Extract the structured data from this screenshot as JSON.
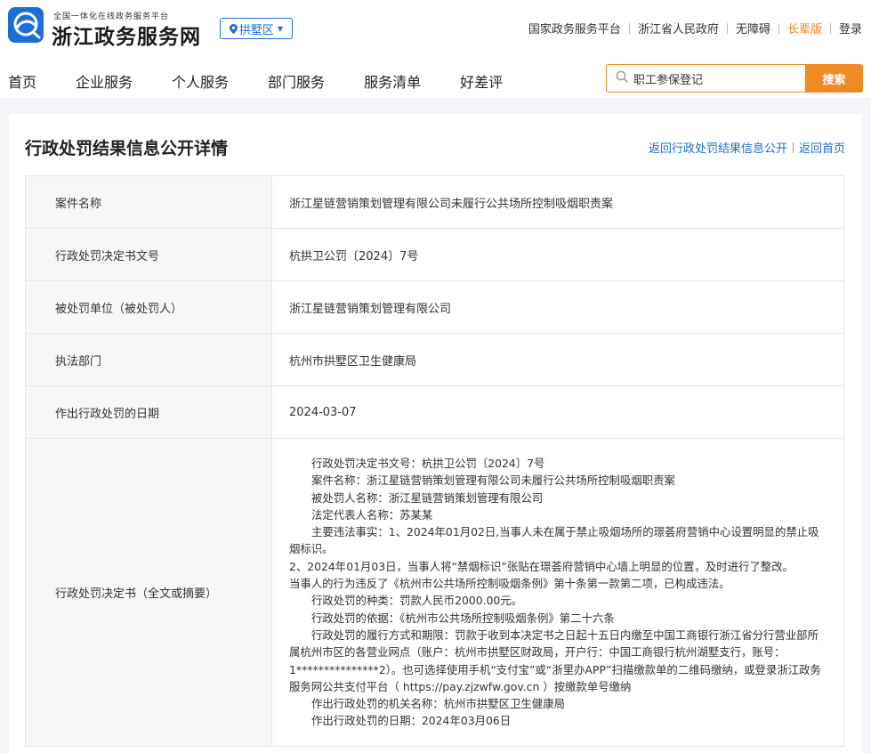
{
  "header": {
    "logo_subtitle": "全国一体化在线政务服务平台",
    "logo_title": "浙江政务服务网",
    "region": "拱墅区",
    "top_links": [
      "国家政务服务平台",
      "浙江省人民政府",
      "无障碍",
      "长辈版",
      "登录"
    ],
    "nav": [
      "首页",
      "企业服务",
      "个人服务",
      "部门服务",
      "服务清单",
      "好差评"
    ],
    "search": {
      "value": "职工参保登记",
      "button": "搜索"
    },
    "colors": {
      "brand_blue": "#1d6fd3",
      "accent_orange": "#f08a24"
    }
  },
  "page": {
    "title": "行政处罚结果信息公开详情",
    "links": [
      "返回行政处罚结果信息公开",
      "返回首页"
    ]
  },
  "details": {
    "rows": [
      {
        "label": "案件名称",
        "value": "浙江星链营销策划管理有限公司未履行公共场所控制吸烟职责案"
      },
      {
        "label": "行政处罚决定书文号",
        "value": "杭拱卫公罚〔2024〕7号"
      },
      {
        "label": "被处罚单位（被处罚人）",
        "value": "浙江星链营销策划管理有限公司"
      },
      {
        "label": "执法部门",
        "value": "杭州市拱墅区卫生健康局"
      },
      {
        "label": "作出行政处罚的日期",
        "value": "2024-03-07"
      }
    ],
    "decision": {
      "label": "行政处罚决定书（全文或摘要）",
      "paragraphs": [
        "行政处罚决定书文号：杭拱卫公罚〔2024〕7号",
        "案件名称：浙江星链营销策划管理有限公司未履行公共场所控制吸烟职责案",
        "被处罚人名称：浙江星链营销策划管理有限公司",
        "法定代表人名称：苏某某",
        "主要违法事实：1、2024年01月02日,当事人未在属于禁止吸烟场所的璟荟府营销中心设置明显的禁止吸烟标识。",
        "2、2024年01月03日，当事人将“禁烟标识”张贴在璟荟府营销中心墙上明显的位置，及时进行了整改。",
        "当事人的行为违反了《杭州市公共场所控制吸烟条例》第十条第一款第二项，已构成违法。",
        "行政处罚的种类：罚款人民币2000.00元。",
        "行政处罚的依据：《杭州市公共场所控制吸烟条例》第二十六条",
        "行政处罚的履行方式和期限：罚款于收到本决定书之日起十五日内缴至中国工商银行浙江省分行营业部所属杭州市区的各营业网点（账户：杭州市拱墅区财政局，开户行：中国工商银行杭州湖墅支行，账号：1***************2）。也可选择使用手机“支付宝”或“浙里办APP”扫描缴款单的二维码缴纳，或登录浙江政务服务网公共支付平台（ https://pay.zjzwfw.gov.cn ）按缴款单号缴纳",
        "作出行政处罚的机关名称：杭州市拱墅区卫生健康局",
        "作出行政处罚的日期：2024年03月06日"
      ]
    }
  }
}
